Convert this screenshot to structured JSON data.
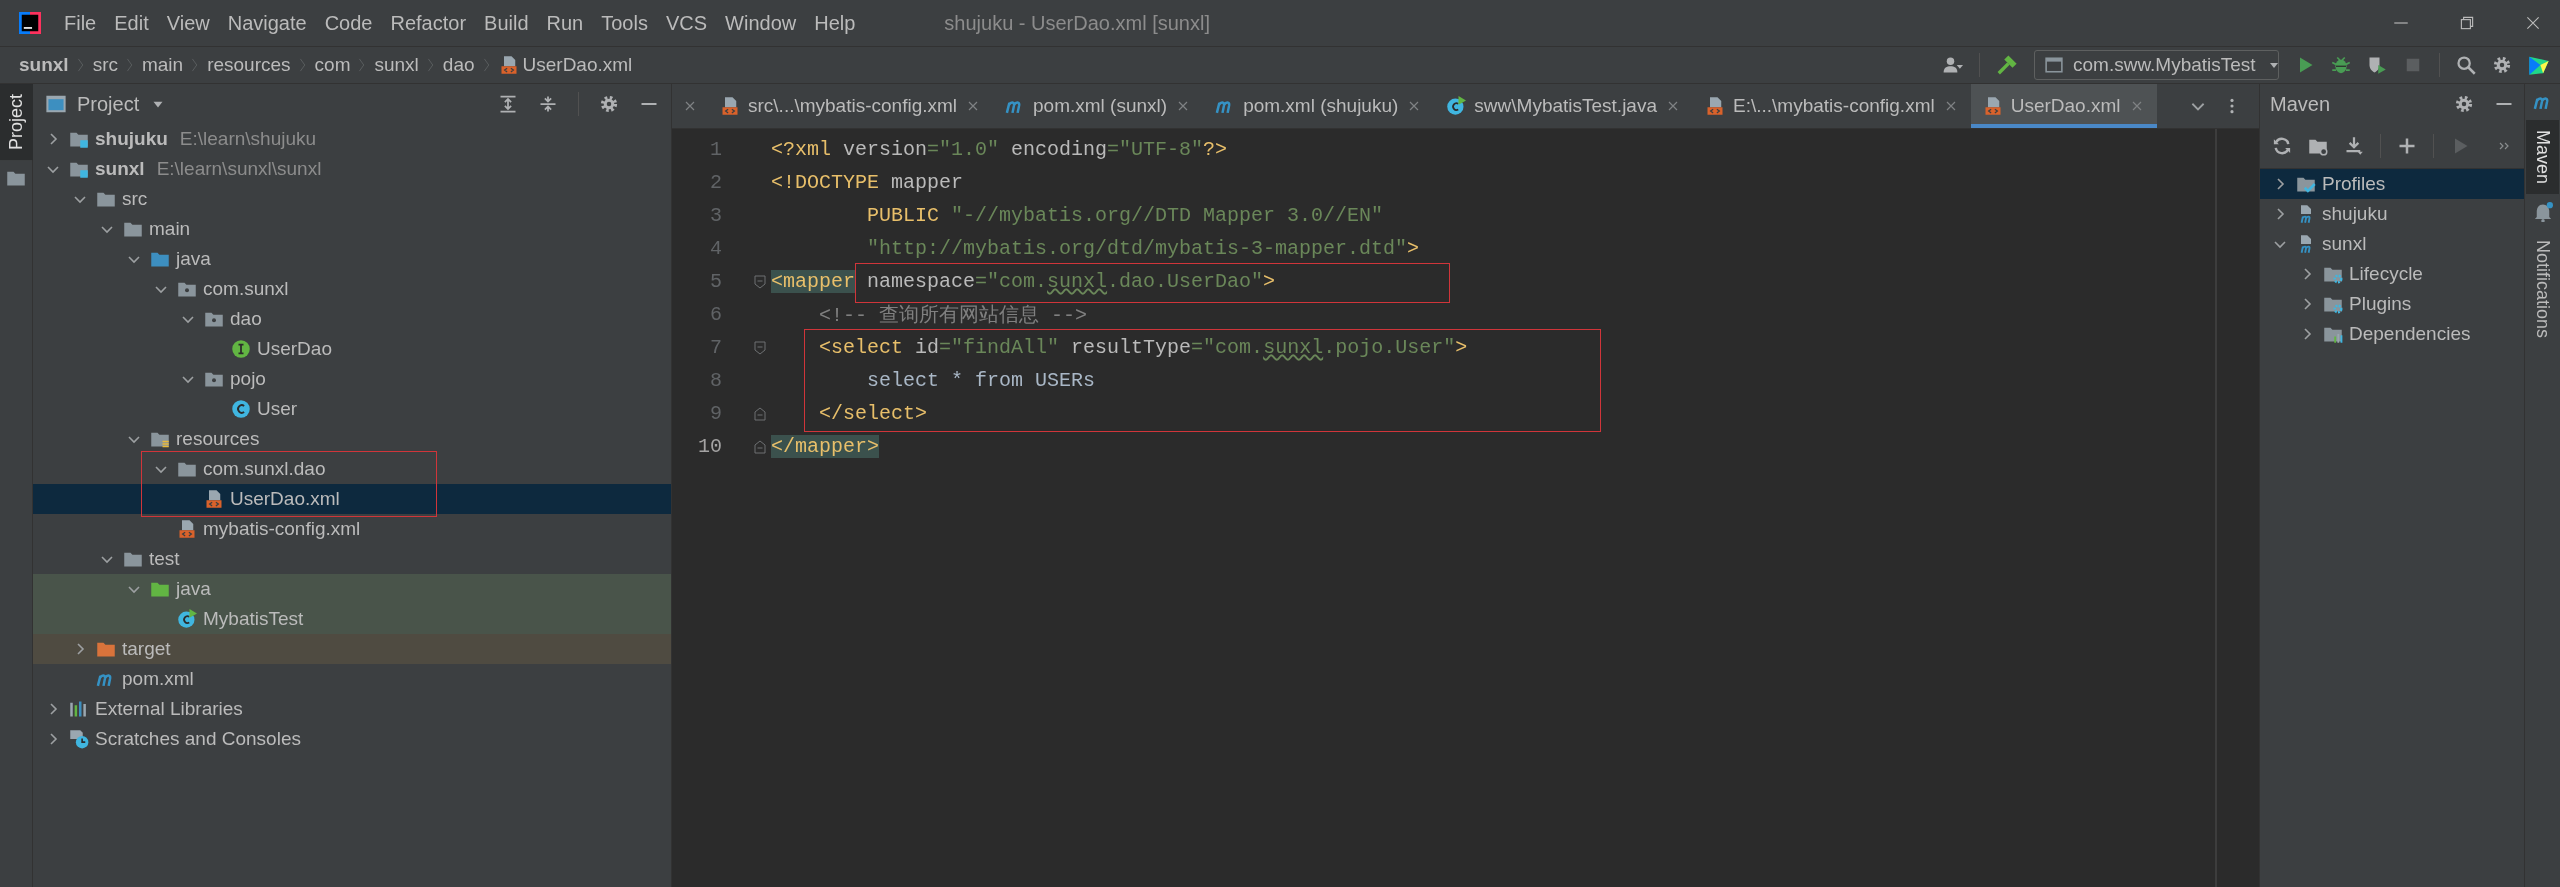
{
  "menu": [
    "File",
    "Edit",
    "View",
    "Navigate",
    "Code",
    "Refactor",
    "Build",
    "Run",
    "Tools",
    "VCS",
    "Window",
    "Help"
  ],
  "window_title": "shujuku - UserDao.xml [sunxl]",
  "breadcrumbs": [
    {
      "label": "sunxl",
      "kind": "root"
    },
    {
      "label": "src",
      "kind": "folder"
    },
    {
      "label": "main",
      "kind": "folder"
    },
    {
      "label": "resources",
      "kind": "folder"
    },
    {
      "label": "com",
      "kind": "folder"
    },
    {
      "label": "sunxl",
      "kind": "folder"
    },
    {
      "label": "dao",
      "kind": "folder"
    },
    {
      "label": "UserDao.xml",
      "kind": "xml"
    }
  ],
  "run_config": "com.sww.MybatisTest",
  "left_stripe": [
    {
      "label": "Project",
      "selected": true
    }
  ],
  "project": {
    "title": "Project",
    "tree": [
      {
        "label": "shujuku",
        "path": "E:\\learn\\shujuku",
        "kind": "module",
        "expanded": false,
        "selected": false
      },
      {
        "label": "sunxl",
        "path": "E:\\learn\\sunxl\\sunxl",
        "kind": "module",
        "expanded": true,
        "selected": false,
        "children": [
          {
            "label": "src",
            "kind": "folder",
            "expanded": true,
            "selected": false,
            "children": [
              {
                "label": "main",
                "kind": "folder",
                "expanded": true,
                "selected": false,
                "children": [
                  {
                    "label": "java",
                    "kind": "source-folder",
                    "expanded": true,
                    "selected": false,
                    "children": [
                      {
                        "label": "com.sunxl",
                        "kind": "package",
                        "expanded": true,
                        "selected": false,
                        "children": [
                          {
                            "label": "dao",
                            "kind": "package",
                            "expanded": true,
                            "selected": false,
                            "children": [
                              {
                                "label": "UserDao",
                                "kind": "interface",
                                "selected": false
                              }
                            ]
                          },
                          {
                            "label": "pojo",
                            "kind": "package",
                            "expanded": true,
                            "selected": false,
                            "children": [
                              {
                                "label": "User",
                                "kind": "class",
                                "selected": false
                              }
                            ]
                          }
                        ]
                      }
                    ]
                  },
                  {
                    "label": "resources",
                    "kind": "resources-folder",
                    "expanded": true,
                    "selected": false,
                    "children": [
                      {
                        "label": "com.sunxl.dao",
                        "kind": "folder",
                        "expanded": true,
                        "selected": false,
                        "in_box": true,
                        "children": [
                          {
                            "label": "UserDao.xml",
                            "kind": "xml",
                            "selected": true,
                            "in_box": true
                          }
                        ]
                      },
                      {
                        "label": "mybatis-config.xml",
                        "kind": "xml",
                        "selected": false
                      }
                    ]
                  }
                ]
              },
              {
                "label": "test",
                "kind": "folder",
                "expanded": true,
                "selected": false,
                "children": [
                  {
                    "label": "java",
                    "kind": "test-folder",
                    "expanded": true,
                    "selected": false,
                    "color": "#49544a",
                    "children": [
                      {
                        "label": "MybatisTest",
                        "kind": "test-class",
                        "selected": false,
                        "color": "#49544a"
                      }
                    ]
                  }
                ]
              }
            ]
          },
          {
            "label": "target",
            "kind": "excluded-folder",
            "expanded": false,
            "selected": false,
            "color": "#4f4b41"
          },
          {
            "label": "pom.xml",
            "kind": "maven-file",
            "selected": false
          }
        ]
      },
      {
        "label": "External Libraries",
        "kind": "libraries",
        "expanded": false,
        "selected": false
      },
      {
        "label": "Scratches and Consoles",
        "kind": "scratches",
        "expanded": false,
        "selected": false
      }
    ]
  },
  "editor": {
    "tabs": [
      {
        "label": "src\\...\\mybatis-config.xml",
        "kind": "xml",
        "selected": false
      },
      {
        "label": "pom.xml (sunxl)",
        "kind": "maven",
        "selected": false
      },
      {
        "label": "pom.xml (shujuku)",
        "kind": "maven",
        "selected": false
      },
      {
        "label": "sww\\MybatisTest.java",
        "kind": "test-class",
        "selected": false
      },
      {
        "label": "E:\\...\\mybatis-config.xml",
        "kind": "xml",
        "selected": false
      },
      {
        "label": "UserDao.xml",
        "kind": "xml",
        "selected": true
      }
    ],
    "lines": [
      {
        "number": "1",
        "current": false,
        "fold_start": false,
        "fold_end": false,
        "in_box": false,
        "tokens": [
          {
            "text": "<?xml ",
            "kind": "tag"
          },
          {
            "text": "version",
            "kind": "attr"
          },
          {
            "text": "=\"1.0\" ",
            "kind": "string"
          },
          {
            "text": "encoding",
            "kind": "attr"
          },
          {
            "text": "=\"UTF-8\"",
            "kind": "string"
          },
          {
            "text": "?>",
            "kind": "tag"
          }
        ]
      },
      {
        "number": "2",
        "current": false,
        "fold_start": false,
        "fold_end": false,
        "in_box": false,
        "tokens": [
          {
            "text": "<!DOCTYPE ",
            "kind": "tag"
          },
          {
            "text": "mapper",
            "kind": "attr"
          }
        ]
      },
      {
        "number": "3",
        "current": false,
        "fold_start": false,
        "fold_end": false,
        "in_box": false,
        "tokens": [
          {
            "text": "        PUBLIC ",
            "kind": "tag"
          },
          {
            "text": "\"-//mybatis.org//DTD Mapper 3.0//EN\"",
            "kind": "string"
          }
        ]
      },
      {
        "number": "4",
        "current": false,
        "fold_start": false,
        "fold_end": false,
        "in_box": false,
        "tokens": [
          {
            "text": "        \"http://mybatis.org/dtd/mybatis-3-mapper.dtd\"",
            "kind": "string"
          },
          {
            "text": ">",
            "kind": "tag"
          }
        ]
      },
      {
        "number": "5",
        "current": false,
        "fold_start": true,
        "fold_end": false,
        "in_box": false,
        "tokens": [
          {
            "text": "<mapper",
            "kind": "tag-match"
          }
        ],
        "boxed_tokens": [
          {
            "text": " namespace",
            "kind": "attr"
          },
          {
            "text": "=\"com.",
            "kind": "string"
          },
          {
            "text": "sunxl",
            "kind": "typo"
          },
          {
            "text": ".dao.UserDao\"",
            "kind": "string"
          },
          {
            "text": ">",
            "kind": "tag"
          }
        ]
      },
      {
        "number": "6",
        "current": false,
        "fold_start": false,
        "fold_end": false,
        "in_box": false,
        "tokens": [
          {
            "text": "    <!-- 查询所有网站信息 -->",
            "kind": "comment"
          }
        ]
      },
      {
        "number": "7",
        "current": false,
        "fold_start": true,
        "fold_end": false,
        "in_box": true,
        "tokens": [
          {
            "text": "    <select ",
            "kind": "tag"
          },
          {
            "text": "id",
            "kind": "attr"
          },
          {
            "text": "=\"findAll\" ",
            "kind": "string"
          },
          {
            "text": "resultType",
            "kind": "attr"
          },
          {
            "text": "=\"com.",
            "kind": "string"
          },
          {
            "text": "sunxl",
            "kind": "typo"
          },
          {
            "text": ".pojo.User\"",
            "kind": "string"
          },
          {
            "text": ">",
            "kind": "tag"
          }
        ]
      },
      {
        "number": "8",
        "current": false,
        "fold_start": false,
        "fold_end": false,
        "in_box": true,
        "tokens": [
          {
            "text": "        select * from USERs",
            "kind": "plain"
          }
        ]
      },
      {
        "number": "9",
        "current": false,
        "fold_start": false,
        "fold_end": true,
        "in_box": true,
        "tokens": [
          {
            "text": "    </select>",
            "kind": "tag"
          }
        ]
      },
      {
        "number": "10",
        "current": true,
        "fold_start": false,
        "fold_end": true,
        "in_box": false,
        "tokens": [
          {
            "text": "</mapper>",
            "kind": "tag-match"
          }
        ]
      }
    ]
  },
  "maven": {
    "title": "Maven",
    "tree": [
      {
        "label": "Profiles",
        "kind": "profiles",
        "expanded": false,
        "selected": true
      },
      {
        "label": "shujuku",
        "kind": "maven-module",
        "expanded": false,
        "selected": false
      },
      {
        "label": "sunxl",
        "kind": "maven-module",
        "expanded": true,
        "selected": false,
        "children": [
          {
            "label": "Lifecycle",
            "kind": "gear-folder",
            "expanded": false,
            "selected": false
          },
          {
            "label": "Plugins",
            "kind": "gear-folder",
            "expanded": false,
            "selected": false
          },
          {
            "label": "Dependencies",
            "kind": "deps-folder",
            "expanded": false,
            "selected": false
          }
        ]
      }
    ]
  },
  "right_stripe": [
    {
      "label": "Maven",
      "kind": "maven",
      "selected": true
    },
    {
      "label": "Notifications",
      "kind": "notifications",
      "selected": false
    }
  ]
}
